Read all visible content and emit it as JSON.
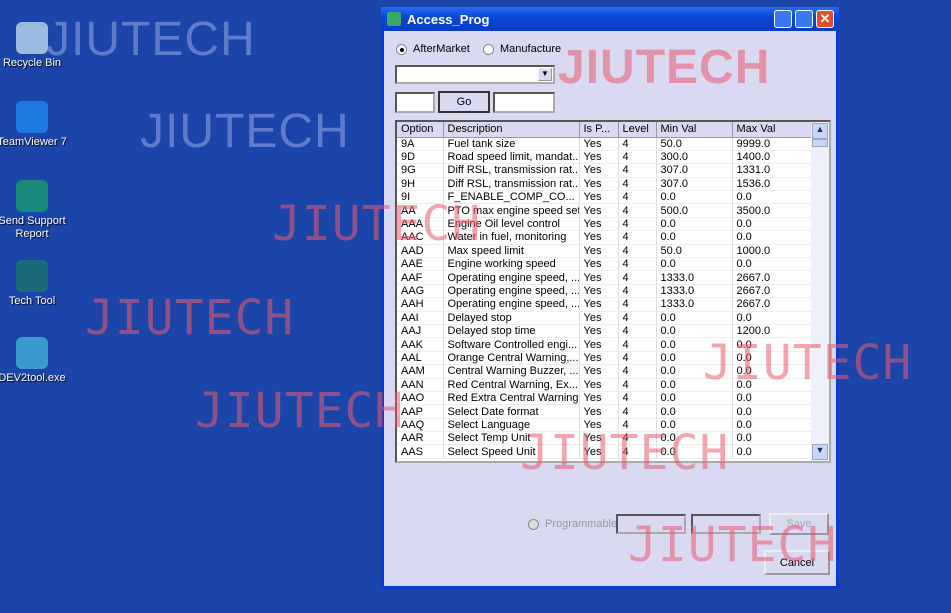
{
  "desktop": {
    "icons": [
      {
        "label": "Recycle Bin",
        "icon": "recycle-bin-icon",
        "color": "#9bd"
      },
      {
        "label": "TeamViewer 7",
        "icon": "teamviewer-icon",
        "color": "#1e7ae0"
      },
      {
        "label": "Send Support Report",
        "icon": "send-report-icon",
        "color": "#1a8a7a"
      },
      {
        "label": "Tech Tool",
        "icon": "tech-tool-icon",
        "color": "#1a6a7a"
      },
      {
        "label": "DEV2tool.exe",
        "icon": "dev2tool-icon",
        "color": "#3a9ad0"
      }
    ]
  },
  "watermark": "JIUTECH",
  "window": {
    "title": "Access_Prog",
    "radio_aftermarket": "AfterMarket",
    "radio_manufacture": "Manufacture",
    "selected": "AfterMarket",
    "go_label": "Go",
    "columns": [
      "Option",
      "Description",
      "Is P...",
      "Level",
      "Min Val",
      "Max Val"
    ],
    "rows": [
      [
        "9A",
        "Fuel tank size",
        "Yes",
        "4",
        "50.0",
        "9999.0"
      ],
      [
        "9D",
        "Road speed limit, mandat...",
        "Yes",
        "4",
        "300.0",
        "1400.0"
      ],
      [
        "9G",
        "Diff RSL, transmission rat...",
        "Yes",
        "4",
        "307.0",
        "1331.0"
      ],
      [
        "9H",
        "Diff RSL, transmission rat...",
        "Yes",
        "4",
        "307.0",
        "1536.0"
      ],
      [
        "9I",
        "F_ENABLE_COMP_CO...",
        "Yes",
        "4",
        "0.0",
        "0.0"
      ],
      [
        "AA",
        "PTO max engine speed set",
        "Yes",
        "4",
        "500.0",
        "3500.0"
      ],
      [
        "AAA",
        "Engine Oil level control",
        "Yes",
        "4",
        "0.0",
        "0.0"
      ],
      [
        "AAC",
        "Water in fuel, monitoring",
        "Yes",
        "4",
        "0.0",
        "0.0"
      ],
      [
        "AAD",
        "Max speed limit",
        "Yes",
        "4",
        "50.0",
        "1000.0"
      ],
      [
        "AAE",
        "Engine working speed",
        "Yes",
        "4",
        "0.0",
        "0.0"
      ],
      [
        "AAF",
        "Operating engine speed, ...",
        "Yes",
        "4",
        "1333.0",
        "2667.0"
      ],
      [
        "AAG",
        "Operating engine speed, ...",
        "Yes",
        "4",
        "1333.0",
        "2667.0"
      ],
      [
        "AAH",
        "Operating engine speed, ...",
        "Yes",
        "4",
        "1333.0",
        "2667.0"
      ],
      [
        "AAI",
        "Delayed stop",
        "Yes",
        "4",
        "0.0",
        "0.0"
      ],
      [
        "AAJ",
        "Delayed stop time",
        "Yes",
        "4",
        "0.0",
        "1200.0"
      ],
      [
        "AAK",
        "Software Controlled engi...",
        "Yes",
        "4",
        "0.0",
        "0.0"
      ],
      [
        "AAL",
        "Orange Central Warning,...",
        "Yes",
        "4",
        "0.0",
        "0.0"
      ],
      [
        "AAM",
        "Central Warning Buzzer, ...",
        "Yes",
        "4",
        "0.0",
        "0.0"
      ],
      [
        "AAN",
        "Red Central Warning, Ex...",
        "Yes",
        "4",
        "0.0",
        "0.0"
      ],
      [
        "AAO",
        "Red Extra Central Warning",
        "Yes",
        "4",
        "0.0",
        "0.0"
      ],
      [
        "AAP",
        "Select Date format",
        "Yes",
        "4",
        "0.0",
        "0.0"
      ],
      [
        "AAQ",
        "Select Language",
        "Yes",
        "4",
        "0.0",
        "0.0"
      ],
      [
        "AAR",
        "Select Temp Unit",
        "Yes",
        "4",
        "0.0",
        "0.0"
      ],
      [
        "AAS",
        "Select Speed Unit",
        "Yes",
        "4",
        "0.0",
        "0.0"
      ]
    ],
    "programmable_label": "Programmable",
    "save_label": "Save",
    "cancel_label": "Cancel"
  }
}
